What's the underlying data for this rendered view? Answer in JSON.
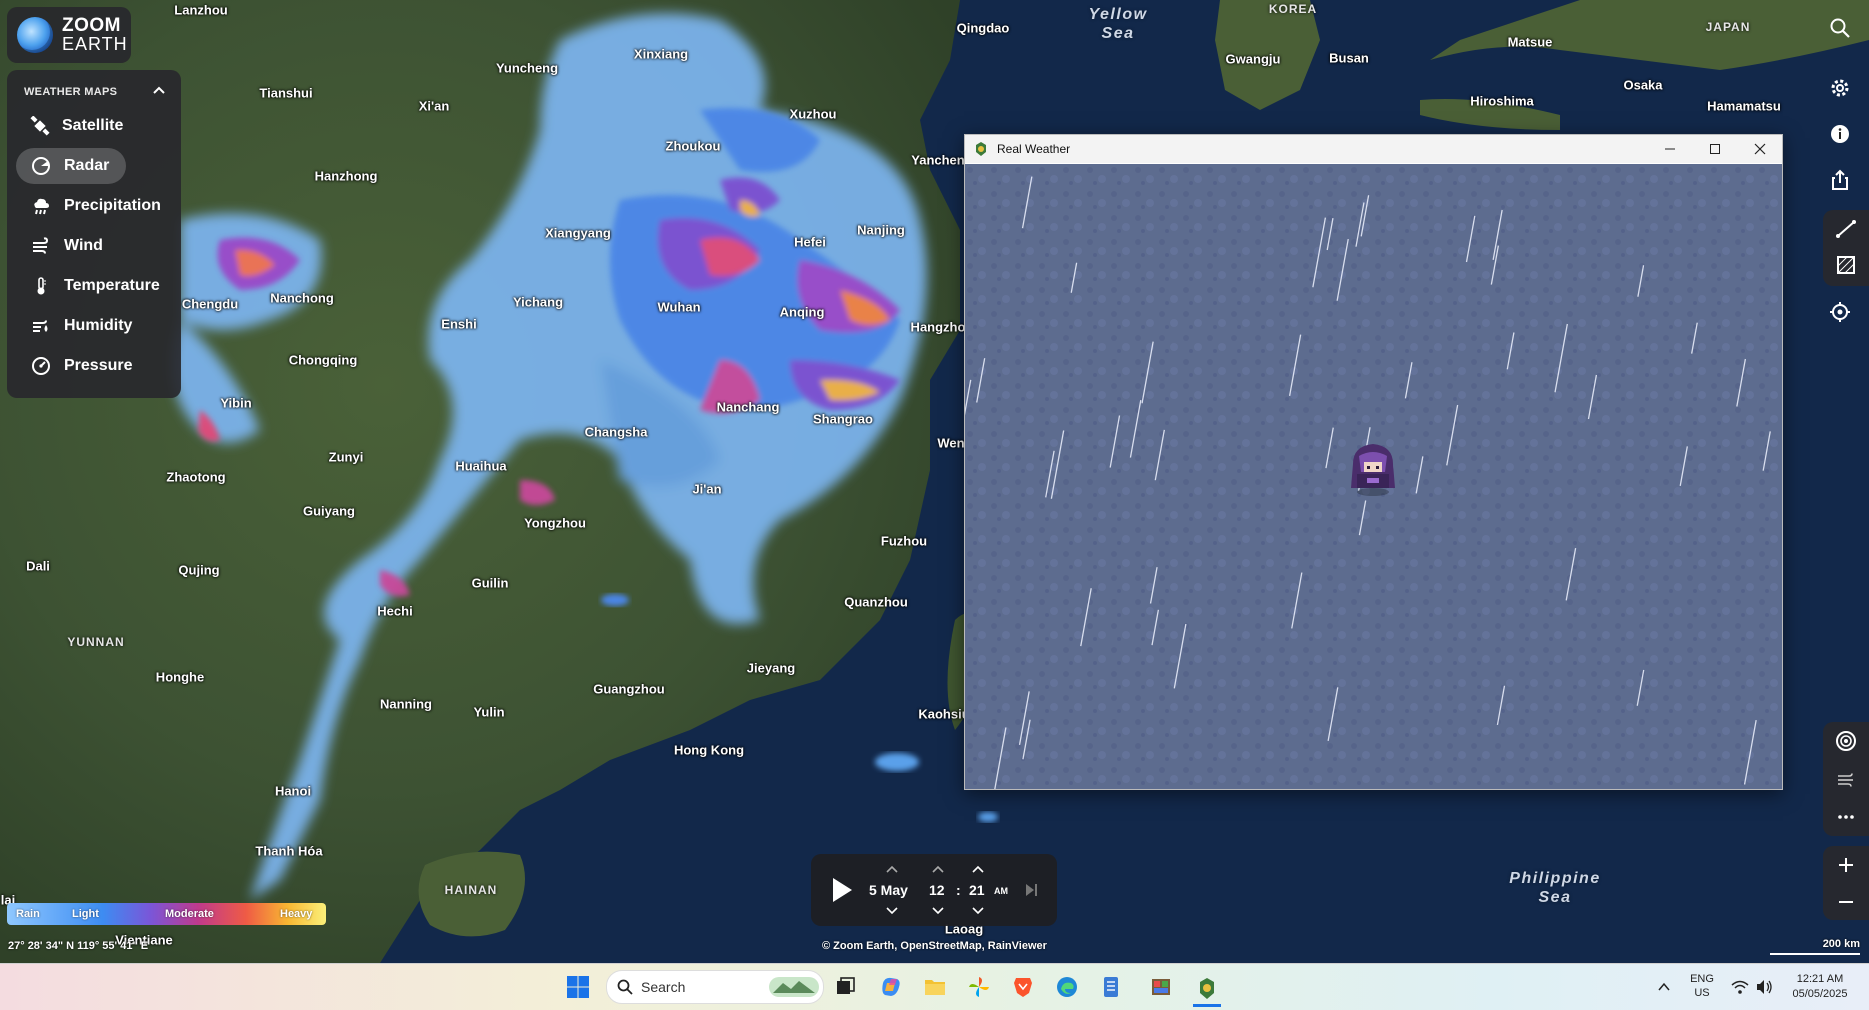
{
  "logo": {
    "line1": "ZOOM",
    "line2": "EARTH"
  },
  "menu": {
    "header": "WEATHER MAPS",
    "items": [
      {
        "label": "Satellite",
        "icon": "satellite-icon"
      },
      {
        "label": "Radar",
        "icon": "radar-icon",
        "active": true
      },
      {
        "label": "Precipitation",
        "icon": "precipitation-icon"
      },
      {
        "label": "Wind",
        "icon": "wind-icon"
      },
      {
        "label": "Temperature",
        "icon": "thermometer-icon"
      },
      {
        "label": "Humidity",
        "icon": "humidity-icon"
      },
      {
        "label": "Pressure",
        "icon": "pressure-icon"
      }
    ]
  },
  "cities": {
    "lanzhou": "Lanzhou",
    "qingdao": "Qingdao",
    "xinxiang": "Xinxiang",
    "yuncheng": "Yuncheng",
    "tianshui": "Tianshui",
    "xian": "Xi'an",
    "xuzhou": "Xuzhou",
    "zhoukou": "Zhoukou",
    "yancheng": "Yanchen",
    "hanzhong": "Hanzhong",
    "xiangyang": "Xiangyang",
    "hefei": "Hefei",
    "nanjing": "Nanjing",
    "chengdu": "Chengdu",
    "nanchong": "Nanchong",
    "enshi": "Enshi",
    "yichang": "Yichang",
    "wuhan": "Wuhan",
    "anqing": "Anqing",
    "hangzhou": "Hangzho",
    "chongqing": "Chongqing",
    "yibin": "Yibin",
    "nanchang": "Nanchang",
    "shangrao": "Shangrao",
    "wen": "Wen",
    "changsha": "Changsha",
    "zunyi": "Zunyi",
    "huaihua": "Huaihua",
    "zhaotong": "Zhaotong",
    "jian": "Ji'an",
    "guiyang": "Guiyang",
    "yongzhou": "Yongzhou",
    "fuzhou": "Fuzhou",
    "dali": "Dali",
    "qujing": "Qujing",
    "guilin": "Guilin",
    "quanzhou": "Quanzhou",
    "hechi": "Hechi",
    "jieyang": "Jieyang",
    "honghe": "Honghe",
    "guangzhou": "Guangzhou",
    "nanning": "Nanning",
    "yulin": "Yulin",
    "kaohsiung": "Kaohsiu",
    "hongkong": "Hong Kong",
    "hanoi": "Hanoi",
    "thanhhoa": "Thanh Hóa",
    "laoag": "Laoag",
    "vientiane": "Vientiane",
    "lai": "lai",
    "gwangju": "Gwangju",
    "busan": "Busan",
    "matsue": "Matsue",
    "hiroshima": "Hiroshima",
    "osaka": "Osaka",
    "hamamatsu": "Hamamatsu"
  },
  "regions": {
    "yunnan": "YUNNAN",
    "hainan": "HAINAN",
    "korea": "KOREA",
    "japan": "JAPAN"
  },
  "seas": {
    "yellow1": "Yellow",
    "yellow2": "Sea",
    "phil1": "Philippine",
    "phil2": "Sea"
  },
  "rain_window": {
    "title": "Real Weather"
  },
  "legend": {
    "rain": "Rain",
    "light": "Light",
    "moderate": "Moderate",
    "heavy": "Heavy"
  },
  "coords": "27° 28' 34\" N   119° 55' 41\" E",
  "time": {
    "day": "5 May",
    "hour": "12",
    "sep": ":",
    "minute": "21",
    "ampm": "AM"
  },
  "attribution": "© Zoom Earth, OpenStreetMap, RainViewer",
  "scale": "200 km",
  "taskbar": {
    "search_placeholder": "Search",
    "lang1": "ENG",
    "lang2": "US",
    "time": "12:21 AM",
    "date": "05/05/2025"
  }
}
